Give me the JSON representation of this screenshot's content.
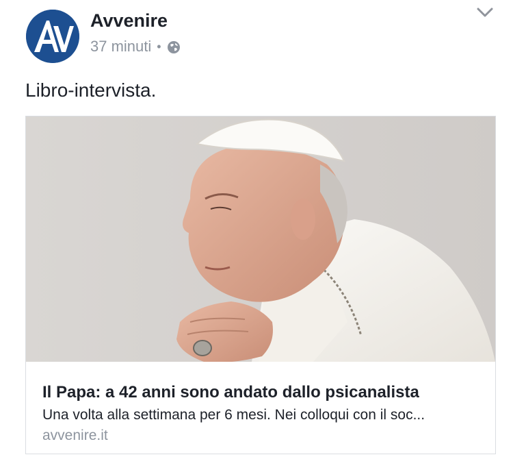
{
  "post": {
    "page_name": "Avvenire",
    "timestamp": "37 minuti",
    "separator": "•",
    "privacy_icon": "globe-icon",
    "menu_icon": "chevron-down-icon",
    "text": "Libro-intervista."
  },
  "avatar": {
    "letters": "AV",
    "background": "#1d4f91"
  },
  "link": {
    "title": "Il Papa: a 42 anni sono andato dallo psicanalista",
    "description": "Una volta alla settimana per 6 mesi. Nei colloqui con il soc...",
    "domain": "avvenire.it"
  },
  "colors": {
    "text": "#1d2129",
    "secondary": "#8d949e",
    "border": "#dadde1"
  }
}
